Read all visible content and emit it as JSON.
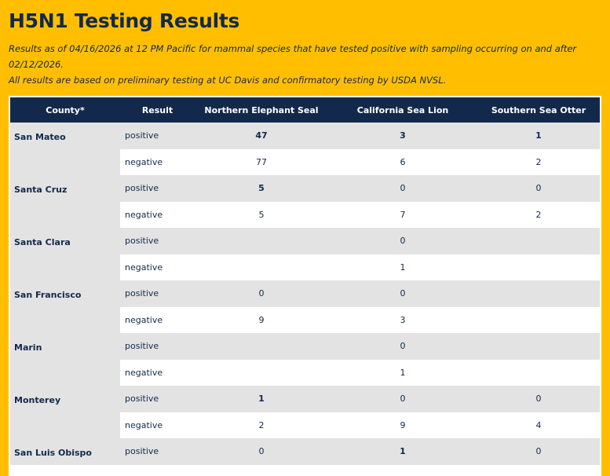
{
  "title": "H5N1 Testing Results",
  "subtitle_line1": "Results as of 04/16/2026 at 12 PM Pacific for mammal species that have tested positive with sampling occurring on and after 02/12/2026.",
  "subtitle_line2": "All results are based on preliminary testing at UC Davis and confirmatory testing by USDA NVSL.",
  "table": {
    "headers": [
      "County*",
      "Result",
      "Northern Elephant Seal",
      "California Sea Lion",
      "Southern Sea Otter"
    ],
    "rows": [
      {
        "county": "San Mateo",
        "results": [
          {
            "result": "positive",
            "values": [
              "47",
              "3",
              "1"
            ]
          },
          {
            "result": "negative",
            "values": [
              "77",
              "6",
              "2"
            ]
          }
        ]
      },
      {
        "county": "Santa Cruz",
        "results": [
          {
            "result": "positive",
            "values": [
              "5",
              "0",
              "0"
            ]
          },
          {
            "result": "negative",
            "values": [
              "5",
              "7",
              "2"
            ]
          }
        ]
      },
      {
        "county": "Santa Clara",
        "results": [
          {
            "result": "positive",
            "values": [
              "",
              "0",
              ""
            ]
          },
          {
            "result": "negative",
            "values": [
              "",
              "1",
              ""
            ]
          }
        ]
      },
      {
        "county": "San Francisco",
        "results": [
          {
            "result": "positive",
            "values": [
              "0",
              "0",
              ""
            ]
          },
          {
            "result": "negative",
            "values": [
              "9",
              "3",
              ""
            ]
          }
        ]
      },
      {
        "county": "Marin",
        "results": [
          {
            "result": "positive",
            "values": [
              "",
              "0",
              ""
            ]
          },
          {
            "result": "negative",
            "values": [
              "",
              "1",
              ""
            ]
          }
        ]
      },
      {
        "county": "Monterey",
        "results": [
          {
            "result": "positive",
            "values": [
              "1",
              "0",
              "0"
            ]
          },
          {
            "result": "negative",
            "values": [
              "2",
              "9",
              "4"
            ]
          }
        ]
      },
      {
        "county": "San Luis Obispo",
        "results": [
          {
            "result": "positive",
            "values": [
              "0",
              "1",
              "0"
            ]
          }
        ]
      }
    ]
  }
}
